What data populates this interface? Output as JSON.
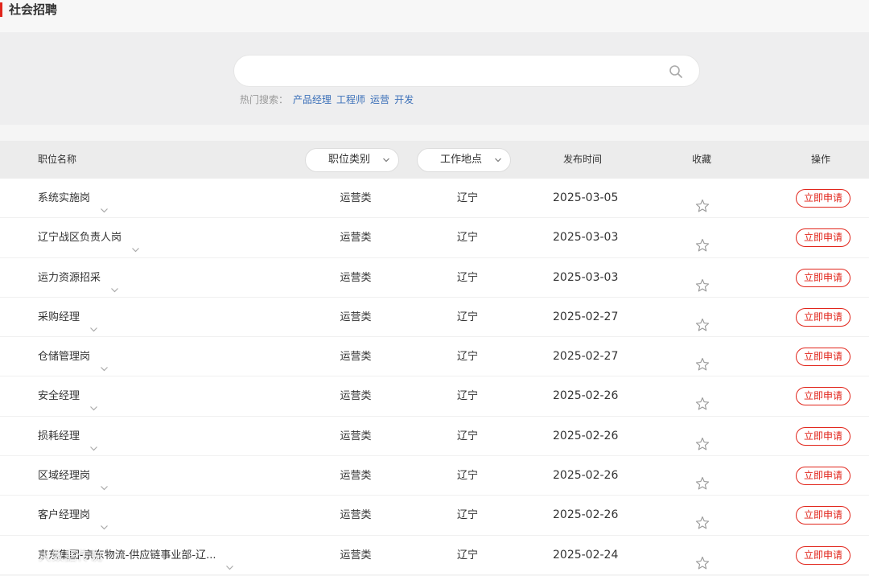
{
  "header": {
    "title": "社会招聘"
  },
  "search": {
    "placeholder": "",
    "value": "",
    "hot_label": "热门搜索：",
    "hot_terms": [
      "产品经理",
      "工程师",
      "运营",
      "开发"
    ]
  },
  "table": {
    "columns": {
      "name": "职位名称",
      "category": "职位类别",
      "location": "工作地点",
      "date": "发布时间",
      "favorite": "收藏",
      "action": "操作"
    },
    "apply_label": "立即申请",
    "rows": [
      {
        "name": "系统实施岗",
        "category": "运营类",
        "location": "辽宁",
        "date": "2025-03-05"
      },
      {
        "name": "辽宁战区负责人岗",
        "category": "运营类",
        "location": "辽宁",
        "date": "2025-03-03"
      },
      {
        "name": "运力资源招采",
        "category": "运营类",
        "location": "辽宁",
        "date": "2025-03-03"
      },
      {
        "name": "采购经理",
        "category": "运营类",
        "location": "辽宁",
        "date": "2025-02-27"
      },
      {
        "name": "仓储管理岗",
        "category": "运营类",
        "location": "辽宁",
        "date": "2025-02-27"
      },
      {
        "name": "安全经理",
        "category": "运营类",
        "location": "辽宁",
        "date": "2025-02-26"
      },
      {
        "name": "损耗经理",
        "category": "运营类",
        "location": "辽宁",
        "date": "2025-02-26"
      },
      {
        "name": "区域经理岗",
        "category": "运营类",
        "location": "辽宁",
        "date": "2025-02-26"
      },
      {
        "name": "客户经理岗",
        "category": "运营类",
        "location": "辽宁",
        "date": "2025-02-26"
      },
      {
        "name": "京东集团-京东物流-供应链事业部-辽...",
        "category": "运营类",
        "location": "辽宁",
        "date": "2025-02-24"
      }
    ]
  },
  "watermark": {
    "text": "大数据传说"
  },
  "colors": {
    "accent": "#e1251b",
    "link": "#3a6fb8"
  }
}
